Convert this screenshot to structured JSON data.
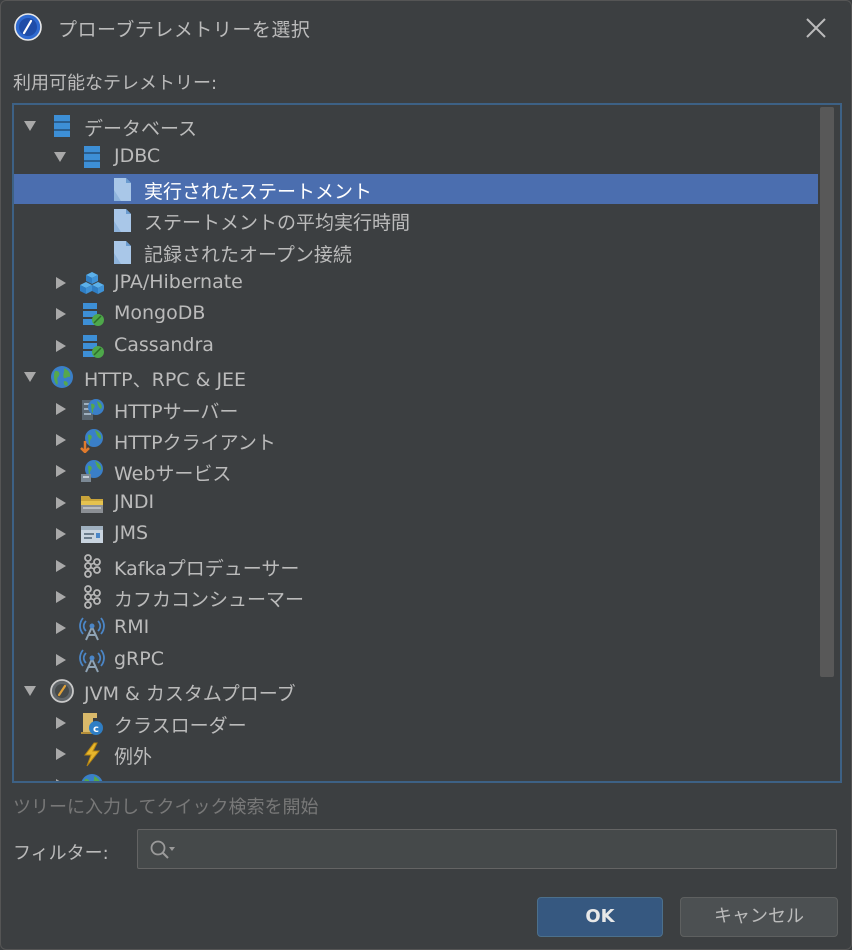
{
  "dialog": {
    "title": "プローブテレメトリーを選択",
    "available_label": "利用可能なテレメトリー:",
    "hint": "ツリーに入力してクイック検索を開始",
    "filter_label": "フィルター:",
    "filter_value": "",
    "ok_label": "OK",
    "cancel_label": "キャンセル"
  },
  "tree": [
    {
      "level": 0,
      "expanded": true,
      "label": "データベース",
      "icon": "database-icon"
    },
    {
      "level": 1,
      "expanded": true,
      "label": "JDBC",
      "icon": "database-icon"
    },
    {
      "level": 2,
      "leaf": true,
      "selected": true,
      "label": "実行されたステートメント",
      "icon": "document-icon"
    },
    {
      "level": 2,
      "leaf": true,
      "label": "ステートメントの平均実行時間",
      "icon": "document-icon"
    },
    {
      "level": 2,
      "leaf": true,
      "label": "記録されたオープン接続",
      "icon": "document-icon"
    },
    {
      "level": 1,
      "expanded": false,
      "label": "JPA/Hibernate",
      "icon": "cubes-icon"
    },
    {
      "level": 1,
      "expanded": false,
      "label": "MongoDB",
      "icon": "database-leaf-icon"
    },
    {
      "level": 1,
      "expanded": false,
      "label": "Cassandra",
      "icon": "database-leaf-icon"
    },
    {
      "level": 0,
      "expanded": true,
      "label": "HTTP、RPC & JEE",
      "icon": "globe-icon"
    },
    {
      "level": 1,
      "expanded": false,
      "label": "HTTPサーバー",
      "icon": "server-globe-icon"
    },
    {
      "level": 1,
      "expanded": false,
      "label": "HTTPクライアント",
      "icon": "client-globe-icon"
    },
    {
      "level": 1,
      "expanded": false,
      "label": "Webサービス",
      "icon": "webservice-icon"
    },
    {
      "level": 1,
      "expanded": false,
      "label": "JNDI",
      "icon": "folder-icon"
    },
    {
      "level": 1,
      "expanded": false,
      "label": "JMS",
      "icon": "message-icon"
    },
    {
      "level": 1,
      "expanded": false,
      "label": "Kafkaプロデューサー",
      "icon": "kafka-icon"
    },
    {
      "level": 1,
      "expanded": false,
      "label": "カフカコンシューマー",
      "icon": "kafka-icon"
    },
    {
      "level": 1,
      "expanded": false,
      "label": "RMI",
      "icon": "antenna-icon"
    },
    {
      "level": 1,
      "expanded": false,
      "label": "gRPC",
      "icon": "antenna-icon"
    },
    {
      "level": 0,
      "expanded": true,
      "label": "JVM & カスタムプローブ",
      "icon": "gauge-icon"
    },
    {
      "level": 1,
      "expanded": false,
      "label": "クラスローダー",
      "icon": "classloader-icon"
    },
    {
      "level": 1,
      "expanded": false,
      "label": "例外",
      "icon": "lightning-icon"
    },
    {
      "level": 1,
      "expanded": false,
      "label": "",
      "icon": "globe-icon"
    }
  ],
  "colors": {
    "background": "#3c3f41",
    "selection": "#4b6eaf",
    "tree_border": "#3d6185",
    "ok_button": "#365880"
  }
}
